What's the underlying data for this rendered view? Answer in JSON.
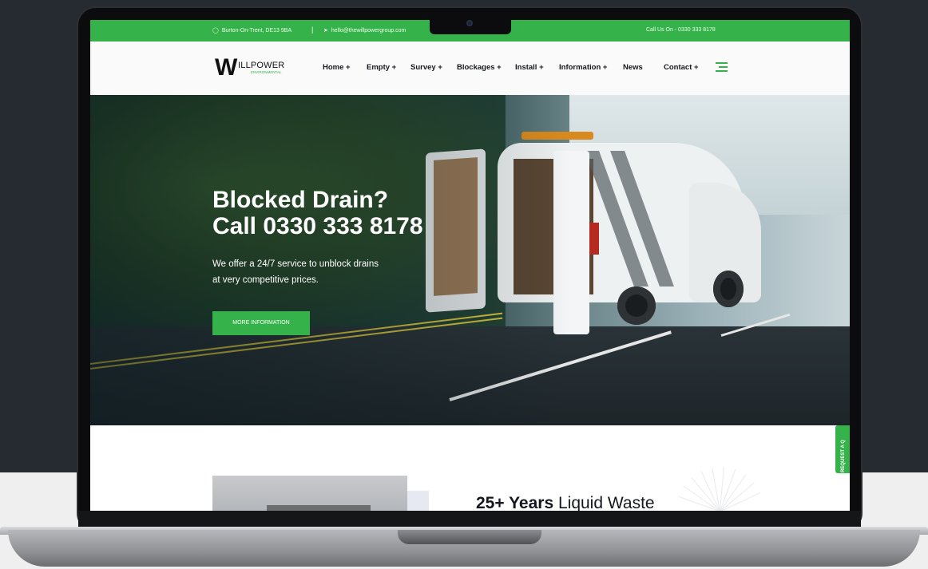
{
  "topbar": {
    "location": "Burton-On-Trent, DE13 9BA",
    "separator": "|",
    "email": "hello@thewillpowergroup.com",
    "call": "Call Us On - 0330 333 8178"
  },
  "logo": {
    "mark": "W",
    "name": "ILLPOWER",
    "sub": "ENVIRONMENTAL"
  },
  "nav": {
    "items": [
      "Home +",
      "Empty +",
      "Survey +",
      "Blockages +",
      "Install +",
      "Information +",
      "News",
      "Contact +"
    ]
  },
  "hero": {
    "title_line1": "Blocked Drain?",
    "title_line2": "Call 0330 333 8178",
    "subtitle_line1": "We offer a 24/7 service to unblock drains",
    "subtitle_line2": "at very competitive prices.",
    "button": "MORE INFORMATION"
  },
  "quote_tab": "REQUEST A Q",
  "section": {
    "years_bold": "25+ Years",
    "years_rest": " Liquid Waste"
  },
  "icons": [
    "location-pin-icon",
    "send-icon",
    "menu-icon"
  ],
  "colors": {
    "brand_green": "#35b24a",
    "text_dark": "#15171f",
    "background_dark": "#262a31"
  }
}
